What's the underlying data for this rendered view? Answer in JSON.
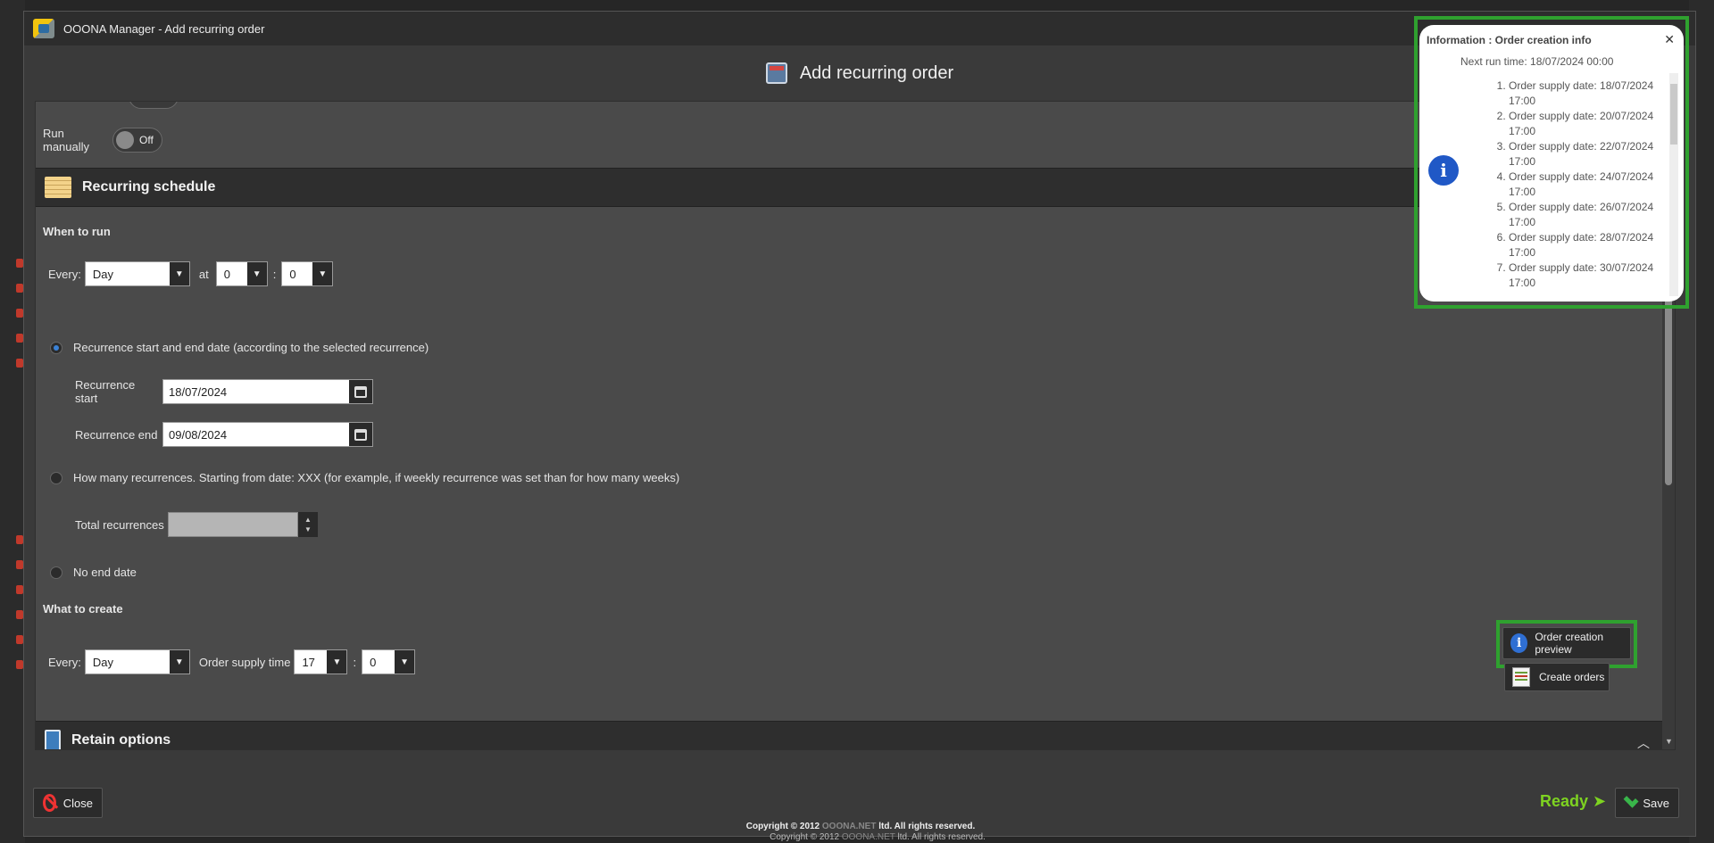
{
  "window": {
    "title": "OOONA Manager - Add recurring order"
  },
  "header": {
    "title": "Add recurring order"
  },
  "run_manually": {
    "label": "Run manually",
    "state": "Off"
  },
  "recurring_schedule": {
    "title": "Recurring schedule",
    "when_to_run": "When to run",
    "every_label": "Every:",
    "every_value": "Day",
    "at_label": "at",
    "hour_value": "0",
    "colon": ":",
    "minute_value": "0",
    "option_start_end": "Recurrence start and end date (according to the selected recurrence)",
    "recurrence_start_label": "Recurrence start",
    "recurrence_start_value": "18/07/2024",
    "recurrence_end_label": "Recurrence end",
    "recurrence_end_value": "09/08/2024",
    "option_how_many": "How many recurrences. Starting from date: XXX (for example, if weekly recurrence was set than for how many weeks)",
    "total_recurrences_label": "Total recurrences",
    "option_no_end": "No end date",
    "what_to_create": "What to create",
    "create_every_label": "Every:",
    "create_every_value": "Day",
    "supply_time_label": "Order supply time",
    "supply_hour_value": "17",
    "supply_colon": ":",
    "supply_minute_value": "0"
  },
  "retain_options": {
    "title": "Retain options"
  },
  "buttons": {
    "preview": "Order creation preview",
    "create_orders": "Create orders",
    "close": "Close",
    "save": "Save"
  },
  "status": {
    "ready": "Ready ➤"
  },
  "footer": {
    "copyright_pre": "Copyright © 2012 ",
    "brand": "OOONA.NET",
    "copyright_post": " ltd. All rights reserved."
  },
  "popup": {
    "title": "Information : Order creation info",
    "next_run": "Next run time: 18/07/2024 00:00",
    "items": [
      "Order supply date: 18/07/2024 17:00",
      "Order supply date: 20/07/2024 17:00",
      "Order supply date: 22/07/2024 17:00",
      "Order supply date: 24/07/2024 17:00",
      "Order supply date: 26/07/2024 17:00",
      "Order supply date: 28/07/2024 17:00",
      "Order supply date: 30/07/2024 17:00"
    ]
  }
}
